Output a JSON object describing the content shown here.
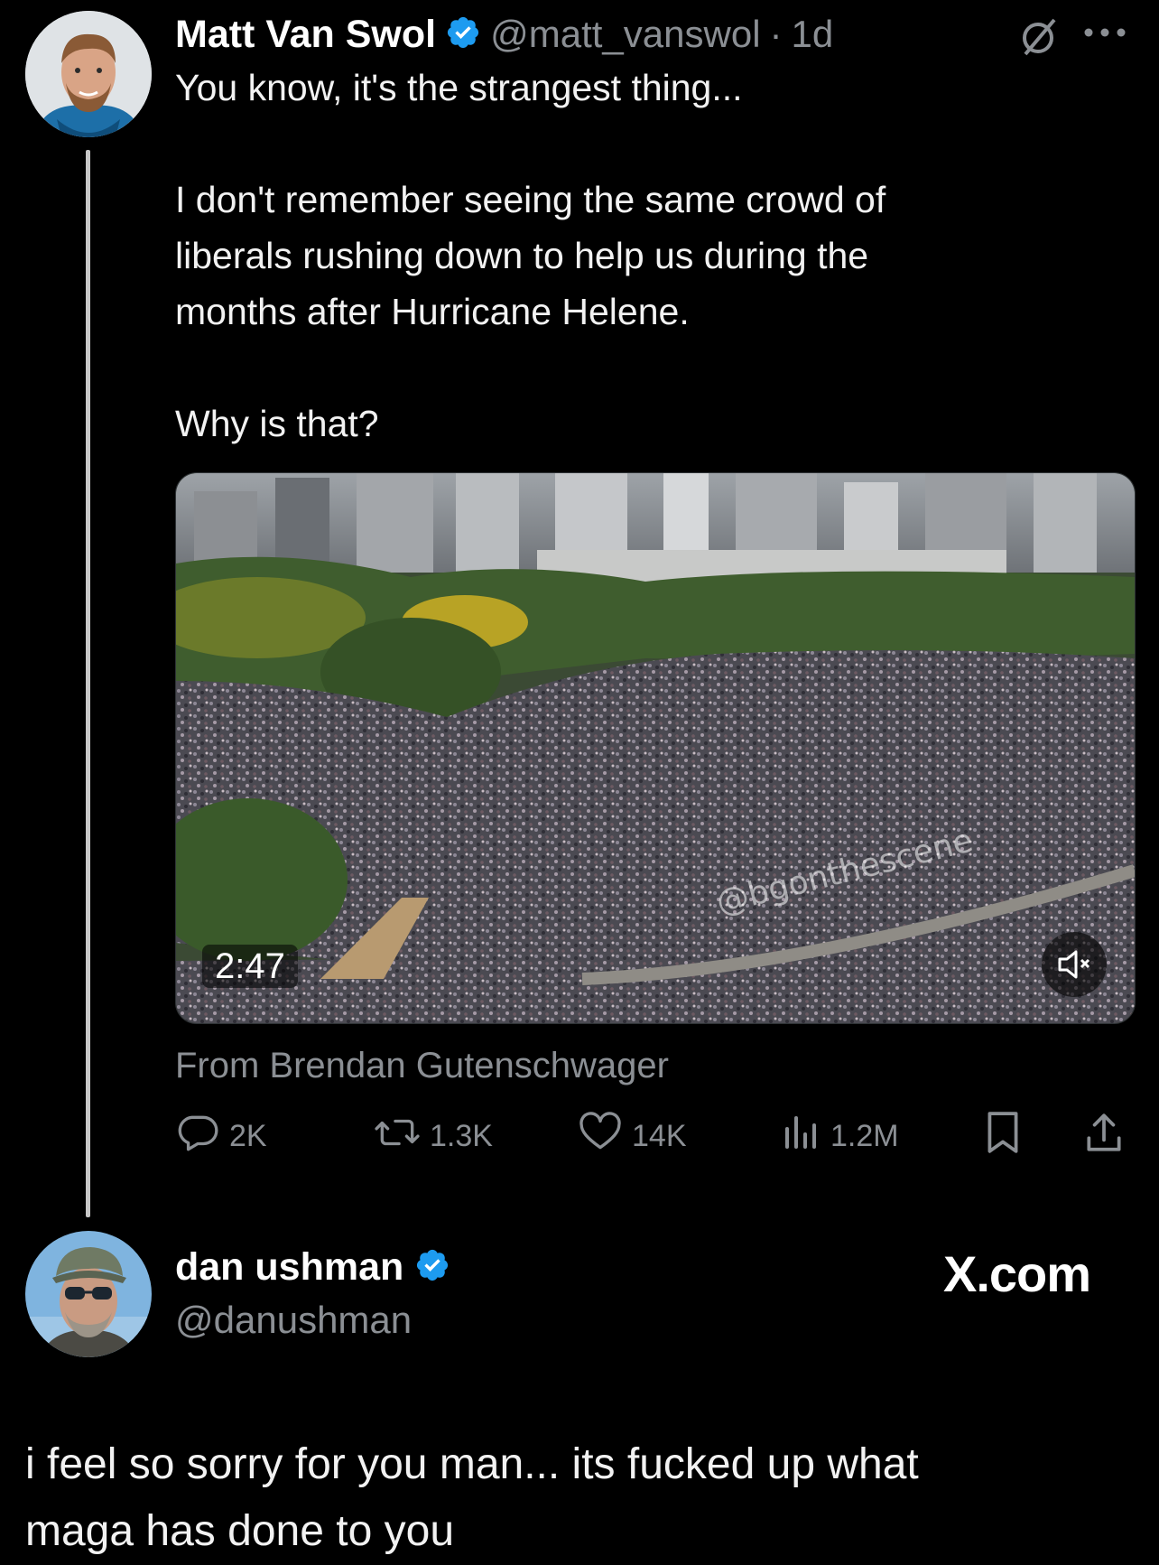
{
  "tweet": {
    "author_name": "Matt Van Swol",
    "handle": "@matt_vanswol",
    "separator": "·",
    "time": "1d",
    "lines": [
      "You know, it's the strangest thing...",
      "I don't remember seeing the same crowd of",
      "liberals rushing down to help us during the",
      "months after Hurricane Helene.",
      "Why is that?"
    ],
    "video_duration": "2:47",
    "video_watermark": "@bgonthescene",
    "source": "From Brendan Gutenschwager",
    "stats": {
      "replies": "2K",
      "reposts": "1.3K",
      "likes": "14K",
      "views": "1.2M"
    },
    "icons": [
      "verified-badge-icon",
      "grok-icon",
      "more-icon",
      "reply-icon",
      "repost-icon",
      "like-icon",
      "views-icon",
      "bookmark-icon",
      "share-icon",
      "mute-icon"
    ]
  },
  "reply": {
    "author_name": "dan ushman",
    "handle": "@danushman",
    "site": "X.com",
    "text_lines": [
      "i feel so sorry for you man... its fucked up what",
      "maga has done to you"
    ]
  },
  "colors": {
    "background": "#000000",
    "verified": "#1d9bf0",
    "muted_text": "#8b8f94"
  }
}
